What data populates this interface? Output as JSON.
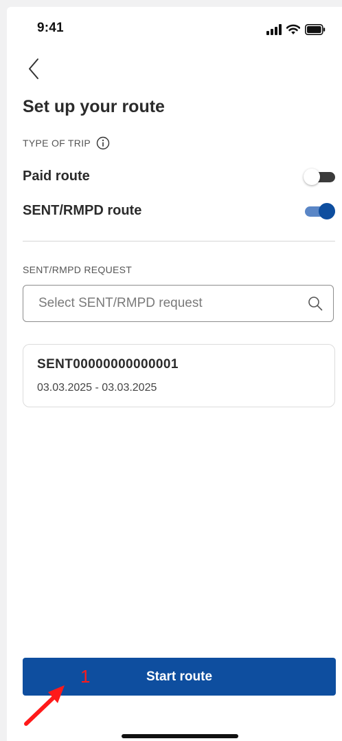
{
  "status_bar": {
    "time": "9:41",
    "icons": [
      "signal-icon",
      "wifi-icon",
      "battery-icon"
    ]
  },
  "header": {
    "back_icon": "chevron-left-icon",
    "title": "Set up your route"
  },
  "trip_type": {
    "label": "TYPE OF TRIP",
    "info_icon": "info-icon",
    "toggles": [
      {
        "label": "Paid route",
        "on": false
      },
      {
        "label": "SENT/RMPD route",
        "on": true
      }
    ]
  },
  "request": {
    "label": "SENT/RMPD REQUEST",
    "search_placeholder": "Select SENT/RMPD request",
    "search_icon": "search-icon",
    "card": {
      "id": "SENT00000000000001",
      "dates": "03.03.2025 - 03.03.2025"
    }
  },
  "footer": {
    "start_label": "Start route"
  },
  "annotation": {
    "number": "1",
    "color": "#ff1a1a"
  },
  "colors": {
    "primary": "#0e4e9f",
    "toggle_on_track": "#5a86c6",
    "toggle_off_track": "#3b3b3b"
  }
}
